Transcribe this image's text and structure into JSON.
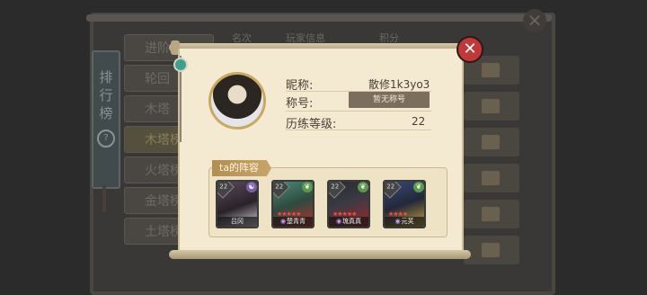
{
  "background": {
    "ribbon_title": "排行榜",
    "ribbon_badge": "?",
    "side_tabs": [
      "进阶",
      "轮回",
      "木塔",
      "木塔榜",
      "火塔榜",
      "金塔榜",
      "土塔榜"
    ],
    "header_columns": [
      "名次",
      "玩家信息",
      "积分"
    ]
  },
  "profile": {
    "nickname_label": "昵称:",
    "nickname_value": "散修1k3yo3",
    "title_label": "称号:",
    "title_value": "暂无称号",
    "level_label": "历练等级:",
    "level_value": "22"
  },
  "lineup": {
    "tag": "ta的阵容",
    "characters": [
      {
        "name": "吕冈",
        "level": "22",
        "element_icon": "yin-yang-icon",
        "stars": "",
        "element_color": "#7a5fb0"
      },
      {
        "name": "楚青青",
        "level": "22",
        "element_icon": "leaf-icon",
        "stars": "★★★★★",
        "element_color": "#5a9a4a"
      },
      {
        "name": "琉真真",
        "level": "22",
        "element_icon": "leaf-icon",
        "stars": "★★★★★",
        "element_color": "#5a9a4a"
      },
      {
        "name": "元芙",
        "level": "22",
        "element_icon": "leaf-icon",
        "stars": "★★★★",
        "element_color": "#5a9a4a"
      }
    ]
  },
  "colors": {
    "close": "#c03838",
    "parchment": "#f4ead2",
    "tag": "#b38e52"
  }
}
